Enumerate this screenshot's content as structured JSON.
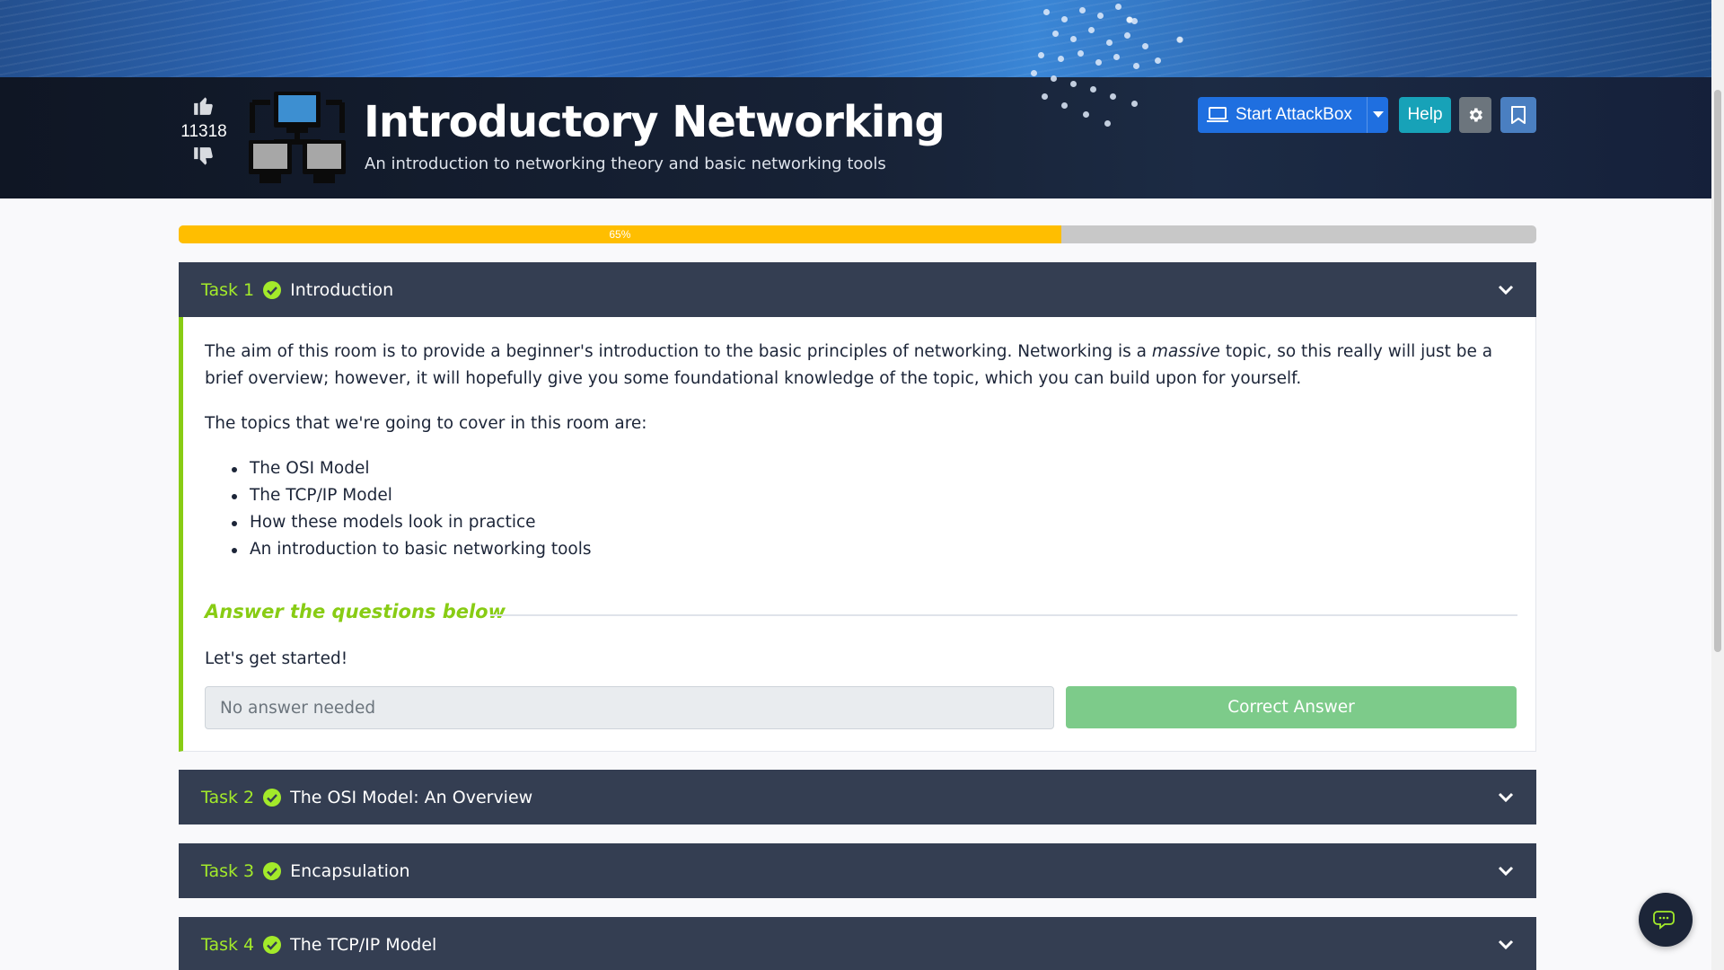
{
  "room": {
    "title": "Introductory Networking",
    "subtitle": "An introduction to networking theory and basic networking tools",
    "votes": "11318"
  },
  "header_buttons": {
    "attackbox_label": "Start AttackBox",
    "help_label": "Help"
  },
  "progress": {
    "percent_label": "65%",
    "value": 0.65,
    "fill_color": "#ffbe00"
  },
  "tasks": [
    {
      "number": "Task 1",
      "title": "Introduction",
      "completed": true,
      "expanded": true
    },
    {
      "number": "Task 2",
      "title": "The OSI Model: An Overview",
      "completed": true,
      "expanded": false
    },
    {
      "number": "Task 3",
      "title": "Encapsulation",
      "completed": true,
      "expanded": false
    },
    {
      "number": "Task 4",
      "title": "The TCP/IP Model",
      "completed": true,
      "expanded": false
    }
  ],
  "task1_body": {
    "para1_before": "The aim of this room is to provide a beginner's introduction to the basic principles of networking. Networking is a ",
    "para1_emph": "massive",
    "para1_after": " topic, so this really will just be a brief overview; however, it will hopefully give you some foundational knowledge of the topic, which you can build upon for yourself.",
    "para2": "The topics that we're going to cover in this room are:",
    "topics": [
      "The OSI Model",
      "The TCP/IP Model",
      "How these models look in practice",
      "An introduction to basic networking tools"
    ],
    "answer_heading": "Answer the questions below",
    "question": "Let's get started!",
    "answer_placeholder": "No answer needed",
    "submit_label": "Correct Answer"
  },
  "colors": {
    "task_accent": "#a3ea2a",
    "task_header_bg": "#343e52",
    "attackbox_blue": "#1f6fe0",
    "help_teal": "#17a2b8",
    "correct_green": "#7dcb8a"
  },
  "icons": [
    "thumbs-up-icon",
    "thumbs-down-icon",
    "network-logo-icon",
    "laptop-icon",
    "caret-down-icon",
    "gear-icon",
    "bookmark-icon",
    "check-circle-icon",
    "chevron-down-icon",
    "chat-icon"
  ]
}
